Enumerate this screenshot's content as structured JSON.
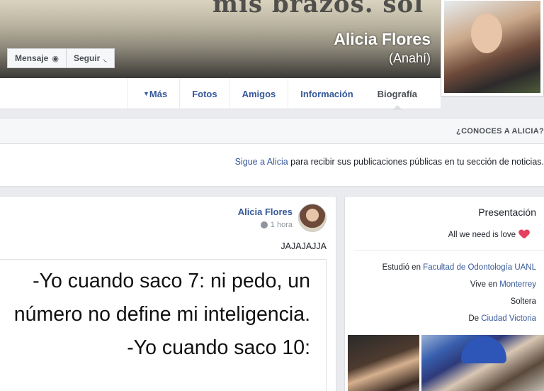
{
  "profile": {
    "name": "Alicia Flores",
    "alias": "(Anahí)",
    "cover_scrawl": "mis brazos. sol"
  },
  "actions": {
    "message": "Mensaje",
    "follow": "Seguir"
  },
  "tabs": [
    {
      "label": "Biografía",
      "active": true
    },
    {
      "label": "Información"
    },
    {
      "label": "Amigos"
    },
    {
      "label": "Fotos"
    },
    {
      "label": "Más"
    }
  ],
  "know": {
    "title": "¿CONOCES A ALICIA?"
  },
  "follow_bar": {
    "link": "Sigue a Alicia",
    "text": " para recibir sus publicaciones públicas en tu sección de noticias."
  },
  "post": {
    "author": "Alicia Flores",
    "time": "1 hora",
    "caption": "JAJAJAJJA",
    "meme_lines": [
      "-Yo cuando saco 7: ni pedo, un",
      "número no define mi inteligencia.",
      "-Yo cuando saco 10:"
    ]
  },
  "intro": {
    "title": "Presentación",
    "bio": "All we need is love",
    "studied_prefix": "Estudió en ",
    "studied_place": "Facultad de Odontología UANL",
    "lives_prefix": "Vive en ",
    "lives_place": "Monterrey",
    "relationship": "Soltera",
    "from_prefix": "De ",
    "from_place": "Ciudad Victoria"
  },
  "colors": {
    "link": "#365899",
    "background": "#e9ebee"
  }
}
